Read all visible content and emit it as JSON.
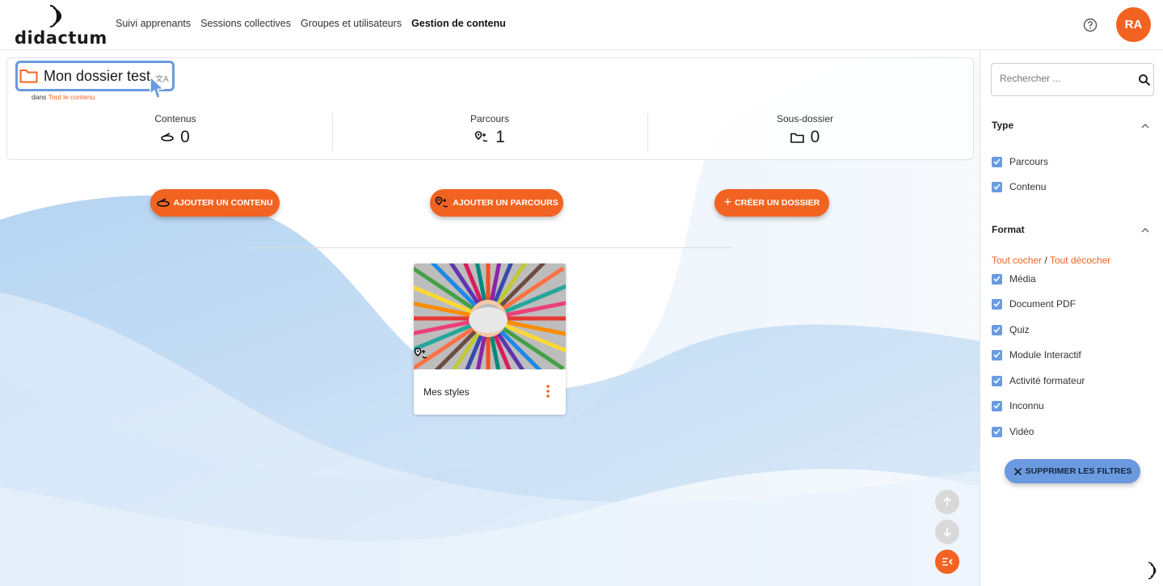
{
  "header": {
    "logo_text": "didactum",
    "nav": [
      "Suivi apprenants",
      "Sessions collectives",
      "Groupes et utilisateurs",
      "Gestion de contenu"
    ],
    "active_nav": "Gestion de contenu",
    "avatar_initials": "RA",
    "help_icon": "help-circle-icon"
  },
  "folder": {
    "title": "Mon dossier test",
    "breadcrumb_prefix": "dans",
    "breadcrumb_link": "Tout le contenu",
    "stats": [
      {
        "label": "Contenus",
        "value": "0",
        "icon": "content-icon"
      },
      {
        "label": "Parcours",
        "value": "1",
        "icon": "route-icon"
      },
      {
        "label": "Sous-dossier",
        "value": "0",
        "icon": "folder-icon"
      }
    ]
  },
  "actions": {
    "add_content": "AJOUTER UN CONTENU",
    "add_route": "AJOUTER UN PARCOURS",
    "create_folder": "CRÉER UN DOSSIER"
  },
  "items": [
    {
      "title": "Mes styles",
      "type_icon": "route-icon"
    }
  ],
  "sidebar": {
    "search_placeholder": "Rechercher ...",
    "type_title": "Type",
    "type_options": [
      "Parcours",
      "Contenu"
    ],
    "format_title": "Format",
    "check_all": "Tout cocher",
    "separator": "/",
    "uncheck_all": "Tout décocher",
    "format_options": [
      "Média",
      "Document PDF",
      "Quiz",
      "Module Interactif",
      "Activité formateur",
      "Inconnu",
      "Vidéo"
    ],
    "clear_filters": "SUPPRIMER LES FILTRES"
  },
  "colors": {
    "accent": "#f26322",
    "filter_blue": "#6b9ae0"
  }
}
